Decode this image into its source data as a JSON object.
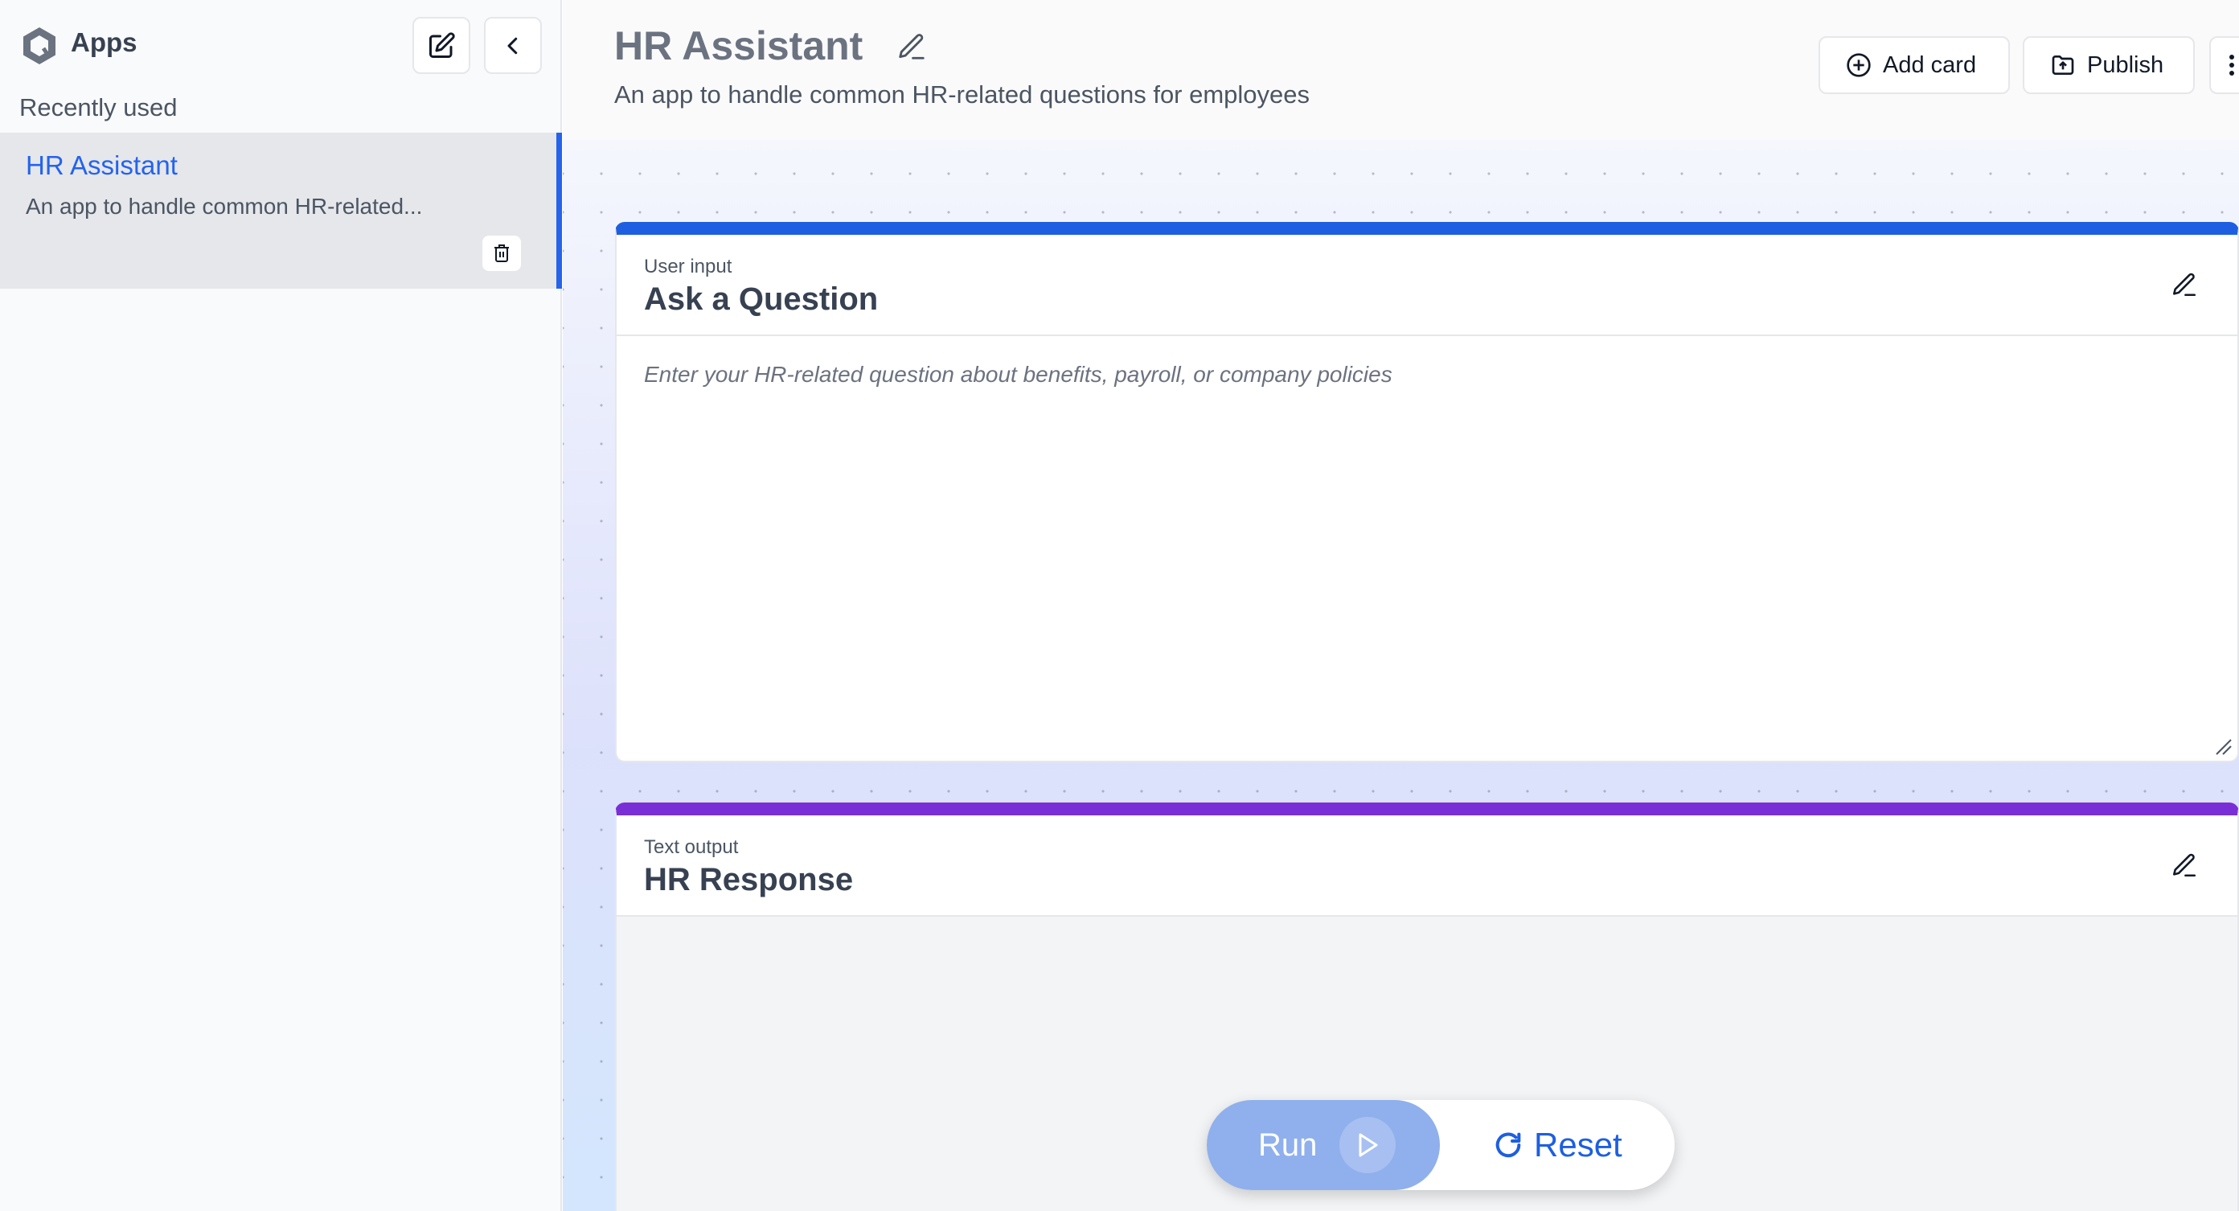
{
  "sidebar": {
    "title": "Apps",
    "section": "Recently used",
    "items": [
      {
        "title": "HR Assistant",
        "description": "An app to handle common HR-related..."
      }
    ]
  },
  "header": {
    "title": "HR Assistant",
    "subtitle": "An app to handle common HR-related questions for employees",
    "add_card_label": "Add card",
    "publish_label": "Publish"
  },
  "cards": {
    "input": {
      "kind": "User input",
      "title": "Ask a Question",
      "placeholder": "Enter your HR-related question about benefits, payroll, or company policies"
    },
    "output": {
      "kind": "Text output",
      "title": "HR Response"
    }
  },
  "controls": {
    "run_label": "Run",
    "reset_label": "Reset"
  },
  "colors": {
    "accent": "#2563eb",
    "input_card": "#1d5fe0",
    "output_card": "#7a2fd6",
    "run_button": "#8fb0ec"
  },
  "icons": [
    "apps-logo-icon",
    "new-app-icon",
    "chevron-left-icon",
    "trash-icon",
    "pencil-icon",
    "plus-circle-icon",
    "folder-upload-icon",
    "more-vertical-icon",
    "play-icon",
    "refresh-icon"
  ]
}
